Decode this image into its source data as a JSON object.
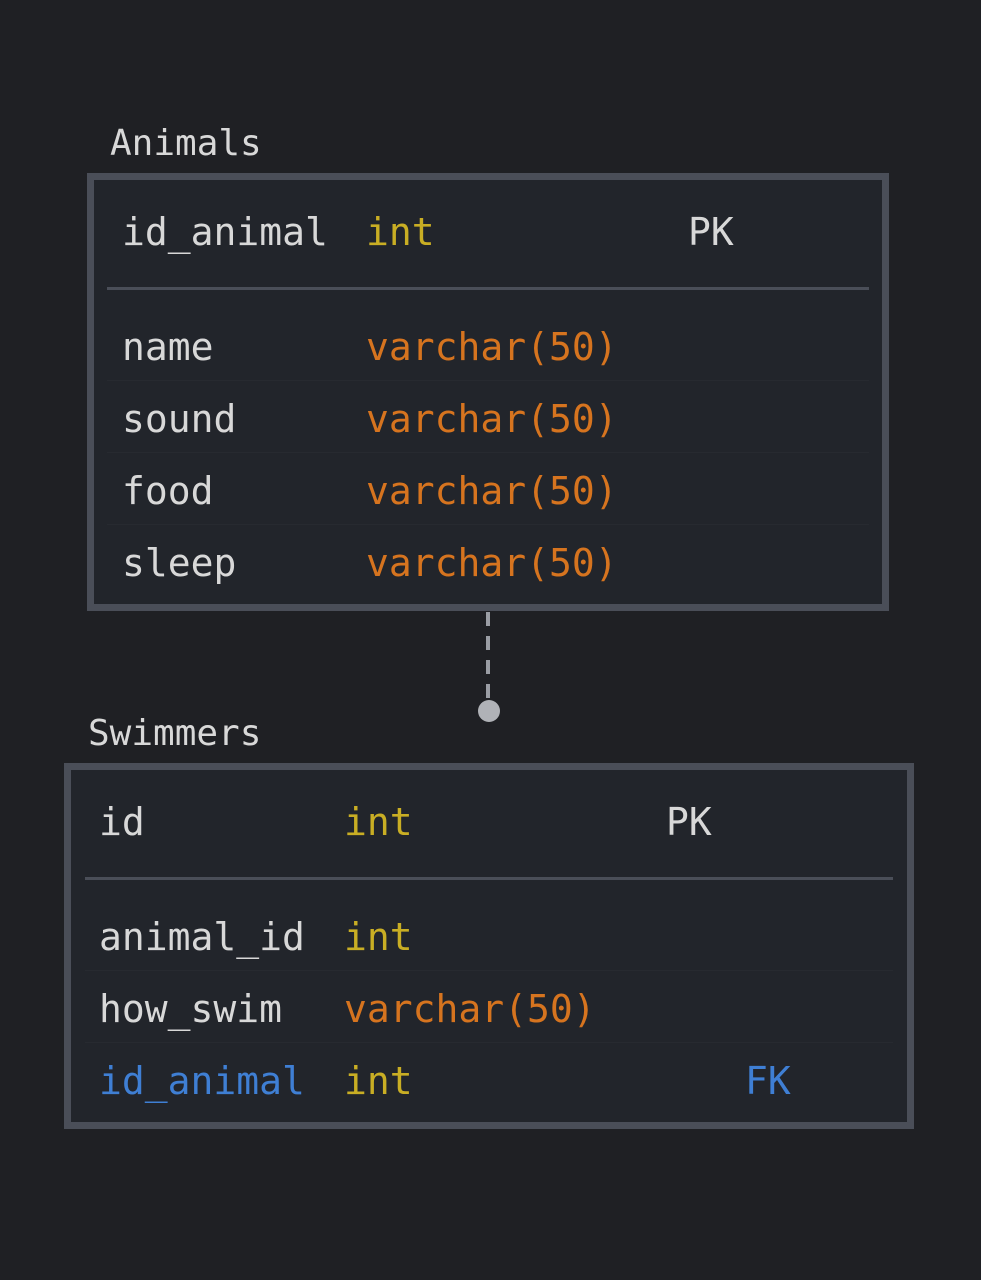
{
  "tables": [
    {
      "title": "Animals",
      "pk": {
        "name": "id_animal",
        "type": "int",
        "key": "PK"
      },
      "fields": [
        {
          "name": "name",
          "type": "varchar(50)"
        },
        {
          "name": "sound",
          "type": "varchar(50)"
        },
        {
          "name": "food",
          "type": "varchar(50)"
        },
        {
          "name": "sleep",
          "type": "varchar(50)"
        }
      ]
    },
    {
      "title": "Swimmers",
      "pk": {
        "name": "id",
        "type": "int",
        "key": "PK"
      },
      "fields": [
        {
          "name": "animal_id",
          "type": "int"
        },
        {
          "name": "how_swim",
          "type": "varchar(50)"
        },
        {
          "name": "id_animal",
          "type": "int",
          "key": "FK"
        }
      ]
    }
  ],
  "colors": {
    "background": "#1f2024",
    "border": "#4a4e58",
    "int": "#c9ae24",
    "varchar": "#d6741f",
    "fk": "#3f7fd4",
    "text": "#d8d8d8"
  }
}
